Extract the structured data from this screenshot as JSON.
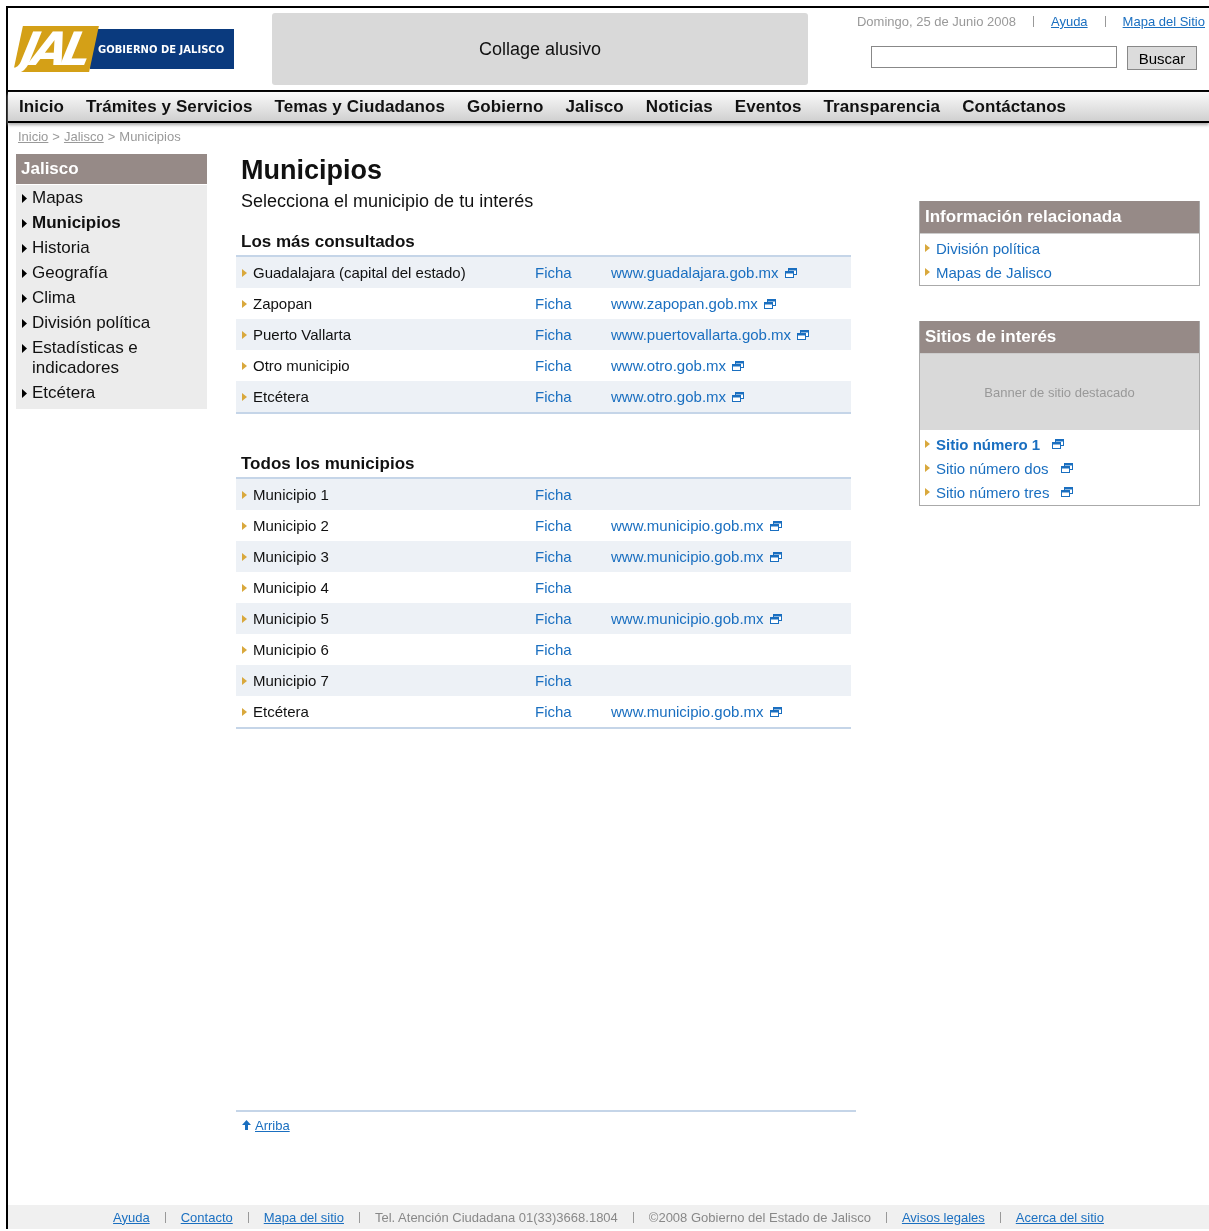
{
  "header": {
    "logo": {
      "mark": "JAL",
      "text": "GOBIERNO DE JALISCO"
    },
    "collage": "Collage alusivo",
    "date": "Domingo, 25 de Junio 2008",
    "links": [
      "Ayuda",
      "Mapa del Sitio"
    ],
    "search": {
      "button": "Buscar"
    }
  },
  "nav": [
    "Inicio",
    "Trámites y Servicios",
    "Temas y Ciudadanos",
    "Gobierno",
    "Jalisco",
    "Noticias",
    "Eventos",
    "Transparencia",
    "Contáctanos"
  ],
  "breadcrumb_separator": ">",
  "breadcrumb": [
    {
      "label": "Inicio",
      "kind": "link"
    },
    {
      "label": "Jalisco",
      "kind": "link"
    },
    {
      "label": "Municipios",
      "kind": "current"
    }
  ],
  "sidebar": {
    "title": "Jalisco",
    "items": [
      {
        "label": "Mapas",
        "selected": false
      },
      {
        "label": "Municipios",
        "selected": true
      },
      {
        "label": "Historia",
        "selected": false
      },
      {
        "label": "Geografía",
        "selected": false
      },
      {
        "label": "Clima",
        "selected": false
      },
      {
        "label": "División política",
        "selected": false
      },
      {
        "label": "Estadísticas e indicadores",
        "selected": false
      },
      {
        "label": "Etcétera",
        "selected": false
      }
    ]
  },
  "main": {
    "title": "Municipios",
    "intro": "Selecciona el municipio de tu interés",
    "sections": [
      {
        "title": "Los más consultados",
        "rows": [
          {
            "name": "Guadalajara (capital del estado)",
            "ficha": "Ficha",
            "url": "www.guadalajara.gob.mx"
          },
          {
            "name": "Zapopan",
            "ficha": "Ficha",
            "url": "www.zapopan.gob.mx"
          },
          {
            "name": "Puerto Vallarta",
            "ficha": "Ficha",
            "url": "www.puertovallarta.gob.mx"
          },
          {
            "name": "Otro municipio",
            "ficha": "Ficha",
            "url": "www.otro.gob.mx"
          },
          {
            "name": "Etcétera",
            "ficha": "Ficha",
            "url": "www.otro.gob.mx"
          }
        ]
      },
      {
        "title": "Todos los municipios",
        "rows": [
          {
            "name": "Municipio 1",
            "ficha": "Ficha"
          },
          {
            "name": "Municipio 2",
            "ficha": "Ficha",
            "url": "www.municipio.gob.mx"
          },
          {
            "name": "Municipio 3",
            "ficha": "Ficha",
            "url": "www.municipio.gob.mx"
          },
          {
            "name": "Municipio 4",
            "ficha": "Ficha"
          },
          {
            "name": "Municipio 5",
            "ficha": "Ficha",
            "url": "www.municipio.gob.mx"
          },
          {
            "name": "Municipio 6",
            "ficha": "Ficha"
          },
          {
            "name": "Municipio 7",
            "ficha": "Ficha"
          },
          {
            "name": "Etcétera",
            "ficha": "Ficha",
            "url": "www.municipio.gob.mx"
          }
        ]
      }
    ],
    "top_link": "Arriba"
  },
  "related": {
    "title": "Información relacionada",
    "links": [
      "División política",
      "Mapas de Jalisco"
    ]
  },
  "sites": {
    "title": "Sitios de interés",
    "banner": "Banner de sitio destacado",
    "links": [
      {
        "label": "Sitio número 1",
        "highlighted": true
      },
      {
        "label": "Sitio número dos",
        "highlighted": false
      },
      {
        "label": "Sitio número tres",
        "highlighted": false
      }
    ]
  },
  "footer": [
    {
      "label": "Ayuda",
      "kind": "link"
    },
    {
      "label": "Contacto",
      "kind": "link"
    },
    {
      "label": "Mapa del sitio",
      "kind": "link"
    },
    {
      "label": "Tel. Atención Ciudadana 01(33)3668.1804",
      "kind": "text"
    },
    {
      "label": "©2008 Gobierno del Estado de Jalisco",
      "kind": "text"
    },
    {
      "label": "Avisos legales",
      "kind": "link"
    },
    {
      "label": "Acerca del sitio",
      "kind": "link"
    }
  ]
}
